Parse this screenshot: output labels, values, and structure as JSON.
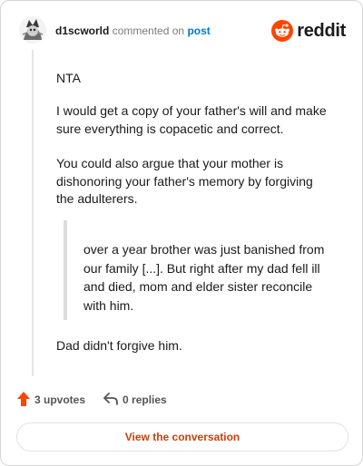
{
  "header": {
    "username": "d1scworld",
    "commented_text": "commented on",
    "post_link": "post",
    "brand": "reddit"
  },
  "comment": {
    "paragraphs": [
      "NTA",
      "I would get a copy of your father's will and make sure everything is copacetic and correct.",
      "You could also argue that your mother is dishonoring your father's memory by forgiving the adulterers."
    ],
    "quote": "over a year brother was just banished from our family [...]. But right after my dad fell ill and died, mom and elder sister reconcile with him.",
    "closing": "Dad didn't forgive him."
  },
  "footer": {
    "upvotes": "3 upvotes",
    "replies": "0 replies"
  },
  "cta": {
    "label": "View the conversation"
  },
  "colors": {
    "reddit_orange": "#ff4500",
    "link_blue": "#0079d3",
    "cta_text": "#c8410b"
  },
  "icons": {
    "avatar": "avatar-icon",
    "reddit_logo": "reddit-logo-icon",
    "upvote": "upvote-arrow-icon",
    "reply": "reply-arrow-icon"
  }
}
